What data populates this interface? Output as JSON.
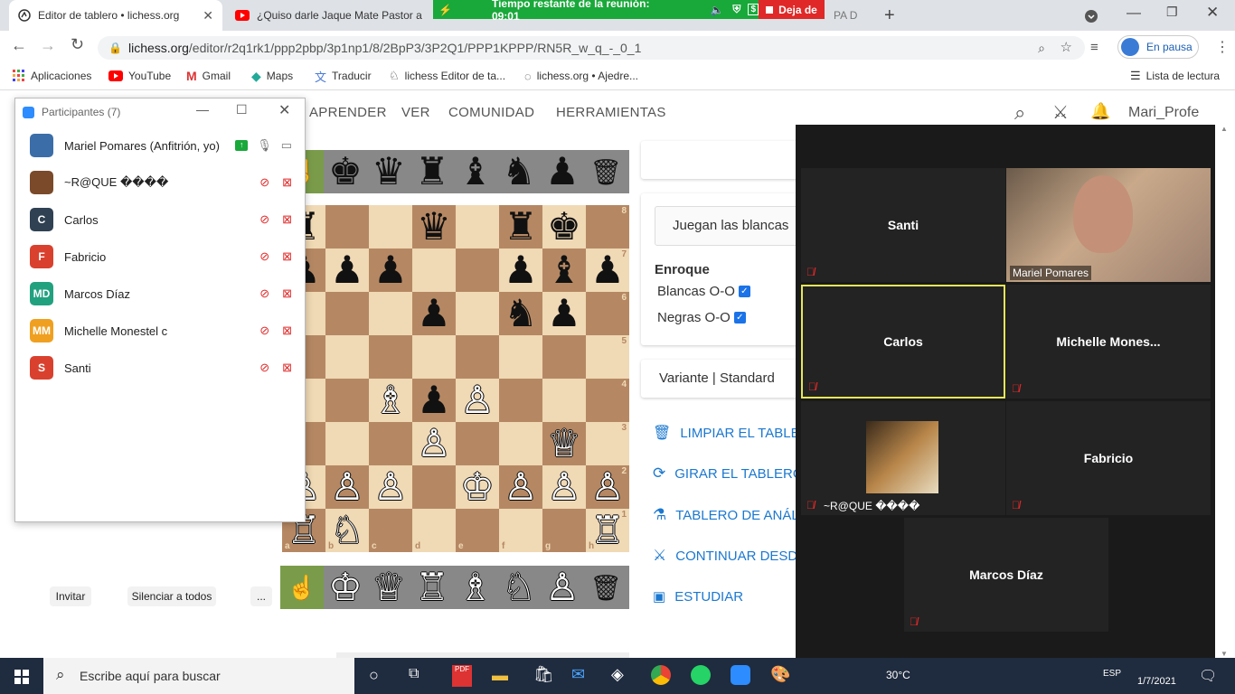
{
  "browser": {
    "tabs": [
      {
        "title": "Editor de tablero • lichess.org",
        "active": true
      },
      {
        "title": "¿Quiso darle Jaque Mate Pastor a",
        "active": false
      },
      {
        "title": "PA D",
        "active": false
      }
    ],
    "new_tab": "+",
    "url_domain": "lichess.org",
    "url_path": "/editor/r2q1rk1/ppp2pbp/3p1np1/8/2BpP3/3P2Q1/PPP1KPPP/RN5R_w_q_-_0_1",
    "profile_label": "En pausa",
    "bookmarks": [
      "Aplicaciones",
      "YouTube",
      "Gmail",
      "Maps",
      "Traducir",
      "lichess Editor de ta...",
      "lichess.org • Ajedre..."
    ],
    "reading_list": "Lista de lectura"
  },
  "meeting": {
    "timer_text": "Tiempo restante de la reunión: 09:01",
    "leave_label": "Deja de"
  },
  "lichess": {
    "nav": [
      "APRENDER",
      "VER",
      "COMUNIDAD",
      "HERRAMIENTAS"
    ],
    "username": "Mari_Profe",
    "turn_label": "Juegan las blancas",
    "castling_title": "Enroque",
    "white_castle": "Blancas O-O",
    "black_castle": "Negras O-O",
    "variant": "Variante | Standard",
    "actions": [
      "LIMPIAR EL TABLERO",
      "GIRAR EL TABLERO",
      "TABLERO DE ANÁLISIS",
      "CONTINUAR DESDE AQUÍ",
      "ESTUDIAR"
    ],
    "ranks": [
      "8",
      "7",
      "6",
      "5",
      "4",
      "3",
      "2",
      "1"
    ],
    "files": [
      "a",
      "b",
      "c",
      "d",
      "e",
      "f",
      "g",
      "h"
    ],
    "board": [
      [
        "r",
        "",
        "",
        "q",
        "",
        "r",
        "k",
        ""
      ],
      [
        "p",
        "p",
        "p",
        "",
        "",
        "p",
        "b",
        "p"
      ],
      [
        "",
        "",
        "",
        "p",
        "",
        "n",
        "p",
        ""
      ],
      [
        "",
        "",
        "",
        "",
        "",
        "",
        "",
        ""
      ],
      [
        "",
        "",
        "B",
        "p",
        "P",
        "",
        "",
        ""
      ],
      [
        "",
        "",
        "",
        "P",
        "",
        "",
        "Q",
        ""
      ],
      [
        "P",
        "P",
        "P",
        "",
        "K",
        "P",
        "P",
        "P"
      ],
      [
        "R",
        "N",
        "",
        "",
        "",
        "",
        "",
        "R"
      ]
    ],
    "white_to_move": true
  },
  "participants": {
    "title": "Participantes (7)",
    "list": [
      {
        "name": "Mariel Pomares (Anfitrión, yo)",
        "initials": "",
        "color": "#3b6ea8"
      },
      {
        "name": "~R@QUE ����",
        "initials": "",
        "color": "#7a4a2a"
      },
      {
        "name": "Carlos",
        "initials": "C",
        "color": "#2f4153"
      },
      {
        "name": "Fabricio",
        "initials": "F",
        "color": "#d9412e"
      },
      {
        "name": "Marcos Díaz",
        "initials": "MD",
        "color": "#22a17f"
      },
      {
        "name": "Michelle Monestel c",
        "initials": "MM",
        "color": "#f0a020"
      },
      {
        "name": "Santi",
        "initials": "S",
        "color": "#d9412e"
      }
    ],
    "invite": "Invitar",
    "mute_all": "Silenciar a todos",
    "more": "..."
  },
  "gallery": {
    "tiles": [
      "Santi",
      "Mariel Pomares",
      "Carlos",
      "Michelle  Mones...",
      "~R@QUE ����",
      "Fabricio",
      "Marcos Díaz"
    ]
  },
  "taskbar": {
    "search_placeholder": "Escribe aquí para buscar",
    "temperature": "30°C",
    "lang": "ESP",
    "date": "1/7/2021"
  },
  "colors": {
    "accent": "#1b78d0",
    "board_light": "#f0d9b5",
    "board_dark": "#b58863",
    "zoom_green": "#19a83a",
    "zoom_red": "#e02828"
  }
}
